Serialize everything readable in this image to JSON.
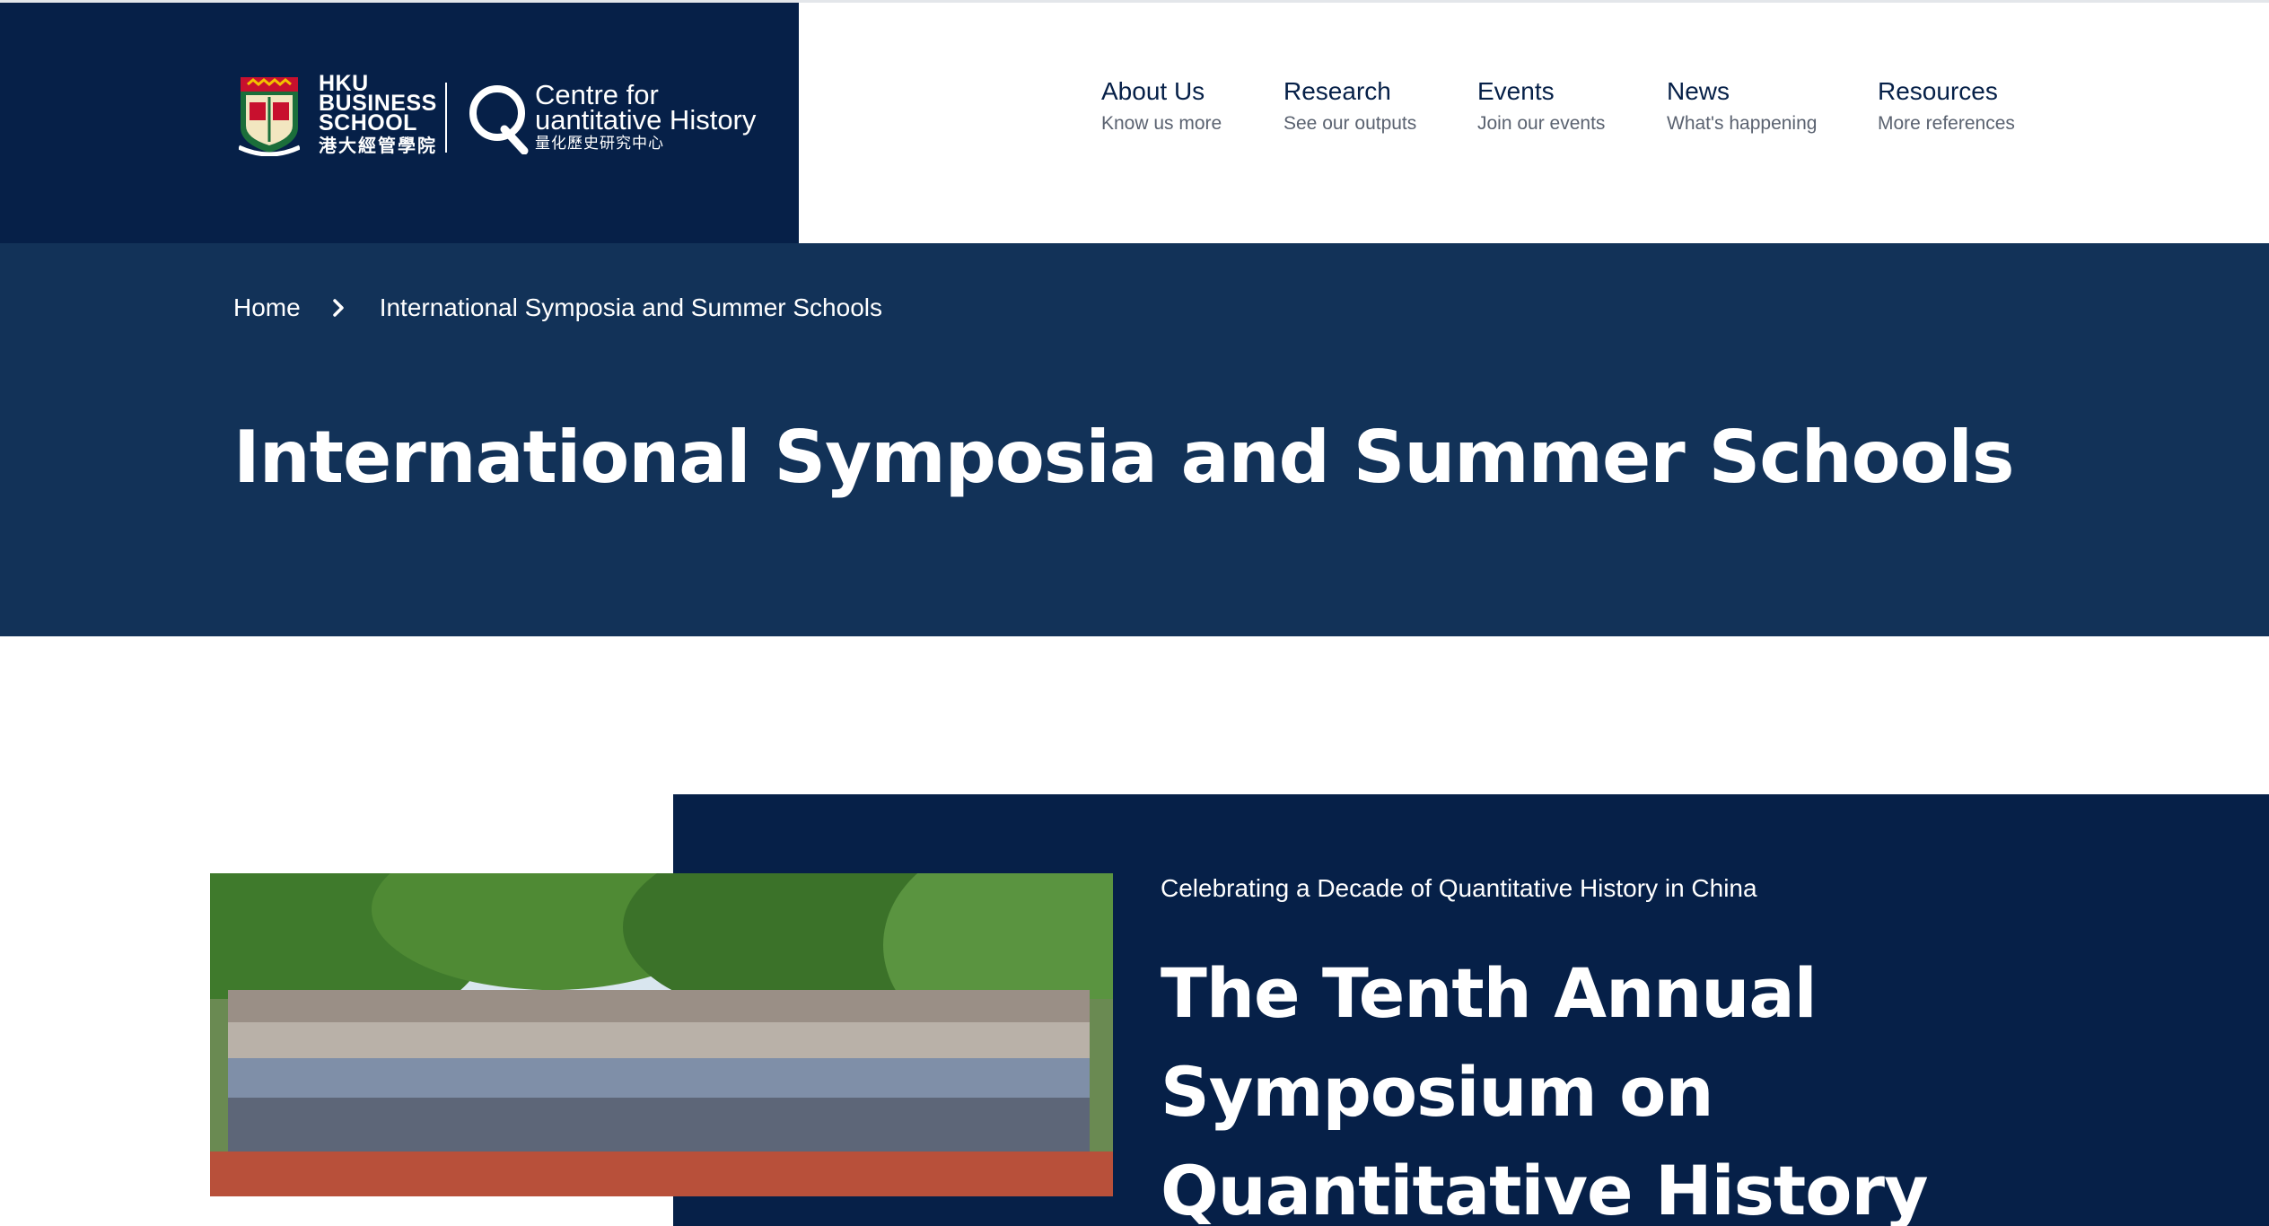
{
  "header": {
    "school_name_line1": "HKU",
    "school_name_line2": "BUSINESS",
    "school_name_line3": "SCHOOL",
    "school_name_zh": "港大經管學院",
    "centre_name_line1": "Centre for",
    "centre_name_line2": "uantitative History",
    "centre_name_zh": "量化歷史研究中心",
    "q_letter": "Q"
  },
  "nav": {
    "items": [
      {
        "label": "About Us",
        "sublabel": "Know us more"
      },
      {
        "label": "Research",
        "sublabel": "See our outputs"
      },
      {
        "label": "Events",
        "sublabel": "Join our events"
      },
      {
        "label": "News",
        "sublabel": "What's happening"
      },
      {
        "label": "Resources",
        "sublabel": "More references"
      }
    ]
  },
  "breadcrumb": {
    "home": "Home",
    "current": "International Symposia and Summer Schools"
  },
  "page": {
    "title": "International Symposia and Summer Schools"
  },
  "feature": {
    "kicker": "Celebrating a Decade of Quantitative History in China",
    "title": "The Tenth Annual Symposium on Quantitative History"
  },
  "colors": {
    "navy_dark": "#062048",
    "navy_hero": "#123258",
    "crest_red": "#c8102e",
    "crest_gold": "#f2c200"
  }
}
